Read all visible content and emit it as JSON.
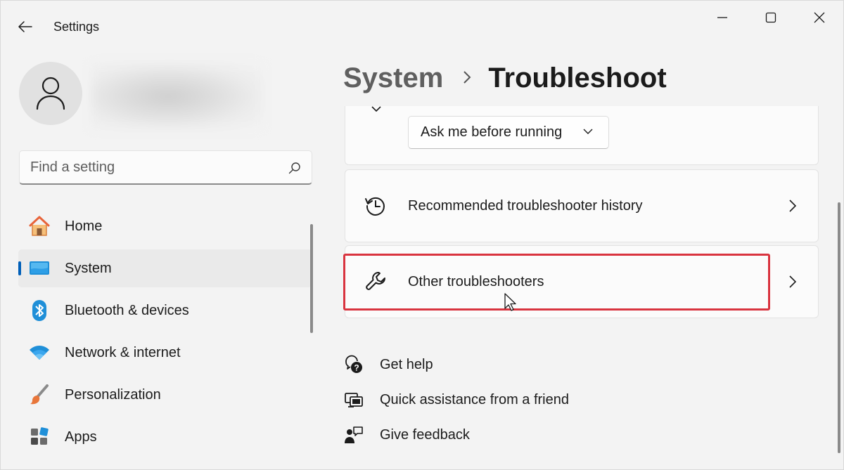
{
  "window": {
    "title": "Settings"
  },
  "profile": {
    "name_blurred": true
  },
  "search": {
    "placeholder": "Find a setting",
    "value": ""
  },
  "sidebar": {
    "items": [
      {
        "label": "Home",
        "icon": "home-icon",
        "active": false
      },
      {
        "label": "System",
        "icon": "system-icon",
        "active": true
      },
      {
        "label": "Bluetooth & devices",
        "icon": "bluetooth-icon",
        "active": false
      },
      {
        "label": "Network & internet",
        "icon": "wifi-icon",
        "active": false
      },
      {
        "label": "Personalization",
        "icon": "brush-icon",
        "active": false
      },
      {
        "label": "Apps",
        "icon": "apps-icon",
        "active": false
      }
    ]
  },
  "header": {
    "parent": "System",
    "current": "Troubleshoot"
  },
  "settings": {
    "run_dropdown_value": "Ask me before running",
    "history_label": "Recommended troubleshooter history",
    "other_label": "Other troubleshooters"
  },
  "help": {
    "get_help": "Get help",
    "quick_assist": "Quick assistance from a friend",
    "feedback": "Give feedback"
  },
  "colors": {
    "accent": "#005fb8",
    "highlight_border": "#d9343f",
    "background": "#f3f3f3"
  }
}
